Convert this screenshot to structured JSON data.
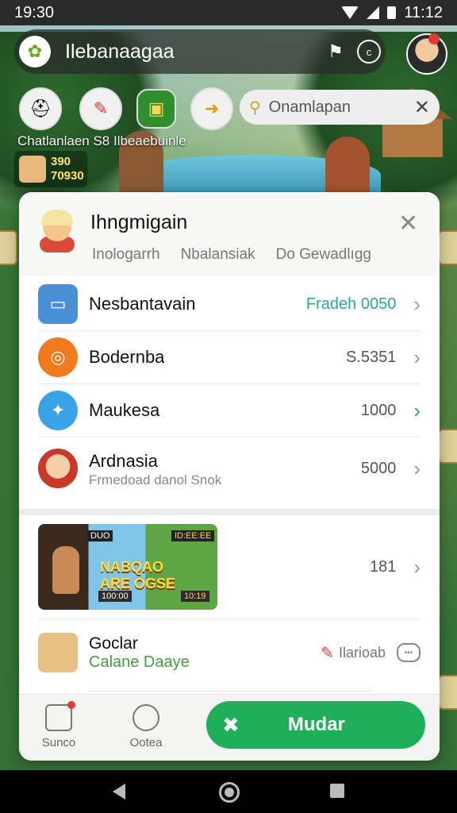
{
  "status_bar": {
    "time": "19:30",
    "clock_right": "11:12"
  },
  "top_bar": {
    "title": "Ilebanaagaa"
  },
  "search": {
    "placeholder": "Onamlapan"
  },
  "banner": {
    "subtitle": "Chatlanlaen S8 Ilbeaebuinle",
    "score_1": "390",
    "score_2": "70930"
  },
  "modal": {
    "title": "Ihngmigain",
    "tabs": [
      "Inologarrh",
      "Nbalansiak",
      "Do Gewadlıgg"
    ],
    "rows": [
      {
        "label": "Nesbantavain",
        "value": "Fradeh 0050",
        "icon": "bus-icon",
        "accent": "#2aa88f"
      },
      {
        "label": "Bodernba",
        "value": "S.5351",
        "icon": "swirl-icon"
      },
      {
        "label": "Maukesa",
        "value": "1000",
        "icon": "bird-icon",
        "accent": "#2db04a"
      },
      {
        "label": "Ardnasia",
        "value": "5000",
        "sublabel": "Frmedoad danol Snok",
        "icon": "avatar-icon"
      }
    ],
    "promo": {
      "title_line_1": "NABQAO",
      "title_line_2": "ARE OGSE",
      "tag_1": "DUO",
      "tag_2": "ID:EE:EE",
      "tag_3": "100:00",
      "tag_4": "10:19",
      "value": "181"
    },
    "game_row": {
      "title": "Goclar",
      "subtitle": "Calane Daaye",
      "badge": "Ilarioab"
    },
    "bottom_bar": {
      "item_1": "Sunco",
      "item_2": "Ootea",
      "cta": "Mudar"
    }
  },
  "colors": {
    "accent_green": "#1fae5a",
    "teal_value": "#2aa88f"
  }
}
